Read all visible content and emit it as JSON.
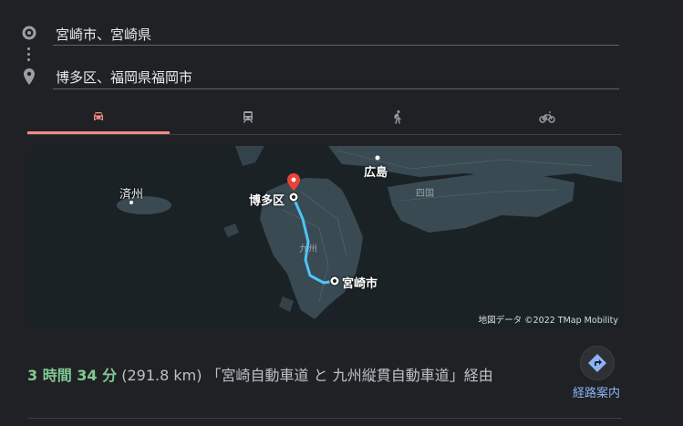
{
  "route": {
    "origin": "宮崎市、宮崎県",
    "destination": "博多区、福岡県福岡市"
  },
  "tabs": [
    {
      "icon": "car-icon",
      "label": "車",
      "active": true
    },
    {
      "icon": "train-icon",
      "label": "公共交通機関",
      "active": false
    },
    {
      "icon": "walk-icon",
      "label": "徒歩",
      "active": false
    },
    {
      "icon": "bicycle-icon",
      "label": "自転車",
      "active": false
    }
  ],
  "map": {
    "labels": {
      "jeju": "済州",
      "hiroshima": "広島",
      "hakata": "博多区",
      "shikoku": "四国",
      "kyushu": "九州",
      "miyazaki": "宮崎市"
    },
    "credit": "地図データ ©2022 TMap Mobility",
    "route_color": "#4fc3f7"
  },
  "summary": {
    "time": "3 時間 34 分",
    "distance": "(291.8 km)",
    "via": "「宮崎自動車道 と 九州縦貫自動車道」経由"
  },
  "directions": {
    "label": "経路案内"
  },
  "colors": {
    "accent_tab": "#f28b82",
    "time_green": "#81c995",
    "link_blue": "#8ab4f8"
  }
}
